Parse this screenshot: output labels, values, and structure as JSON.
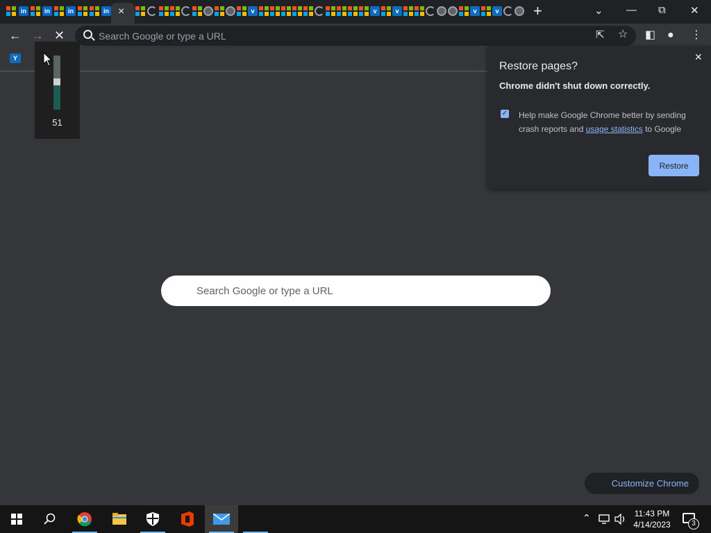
{
  "browser": {
    "omnibox_placeholder": "Search Google or type a URL",
    "tab_close": "×",
    "new_tab": "+"
  },
  "volume": {
    "level": 51,
    "label": "51"
  },
  "restore_dialog": {
    "title": "Restore pages?",
    "message": "Chrome didn't shut down correctly.",
    "checkbox_label_before": "Help make Google Chrome better by sending crash reports and ",
    "checkbox_link": "usage statistics",
    "checkbox_label_after": " to Google",
    "checked": true,
    "button": "Restore"
  },
  "ntp": {
    "search_placeholder": "Search Google or type a URL",
    "customize_button": "Customize Chrome"
  },
  "taskbar": {
    "time": "11:43 PM",
    "date": "4/14/2023",
    "notification_count": "3"
  },
  "colors": {
    "accent": "#8ab4f8",
    "background": "#35363a",
    "tabstrip": "#202124"
  }
}
